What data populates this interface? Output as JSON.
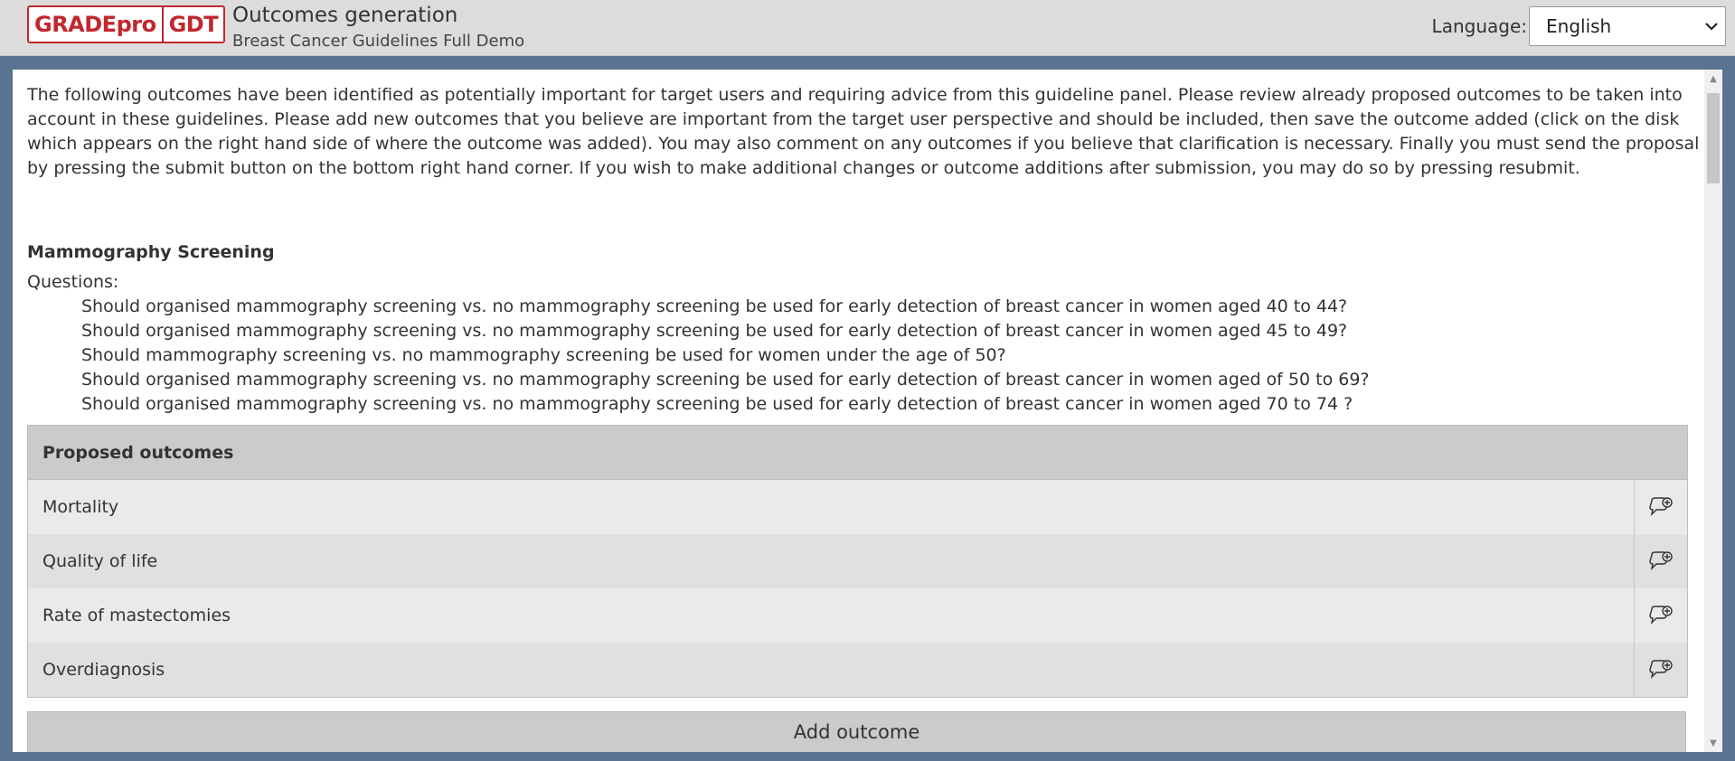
{
  "header": {
    "logo_part1": "GRADEpro",
    "logo_part2": "GDT",
    "title": "Outcomes generation",
    "subtitle": "Breast Cancer Guidelines Full Demo",
    "language_label": "Language:",
    "language_value": "English"
  },
  "intro": "The following outcomes have been identified as potentially important for target users and requiring advice from this guideline panel. Please review already proposed outcomes to be taken into account in these guidelines. Please add new outcomes that you believe are important from the target user perspective and should be included, then save the outcome added (click on the disk which appears on the right hand side of where the outcome was added). You may also comment on any outcomes if you believe that clarification is necessary. Finally you must send the proposal by pressing the submit button on the bottom right hand corner. If you wish to make additional changes or outcome additions after submission, you may do so by pressing resubmit.",
  "section": {
    "title": "Mammography Screening",
    "questions_label": "Questions:",
    "questions": [
      "Should organised mammography screening vs. no mammography screening be used for early detection of breast cancer in women aged 40 to 44?",
      "Should organised mammography screening vs. no mammography screening be used for early detection of breast cancer in women aged 45 to 49?",
      "Should mammography screening vs. no mammography screening be used for women under the age of 50?",
      "Should organised mammography screening vs. no mammography screening be used for early detection of breast cancer in women aged of 50 to 69?",
      "Should organised mammography screening vs. no mammography screening be used for early detection of breast cancer in women aged 70 to 74 ?"
    ]
  },
  "outcomes": {
    "header": "Proposed outcomes",
    "items": [
      {
        "name": "Mortality",
        "action_icon": "add-comment-icon"
      },
      {
        "name": "Quality of life",
        "action_icon": "add-comment-icon"
      },
      {
        "name": "Rate of mastectomies",
        "action_icon": "add-comment-icon"
      },
      {
        "name": "Overdiagnosis",
        "action_icon": "add-comment-icon"
      }
    ],
    "add_button": "Add outcome"
  },
  "colors": {
    "brand_red": "#c1272d",
    "page_background": "#5a7390"
  }
}
